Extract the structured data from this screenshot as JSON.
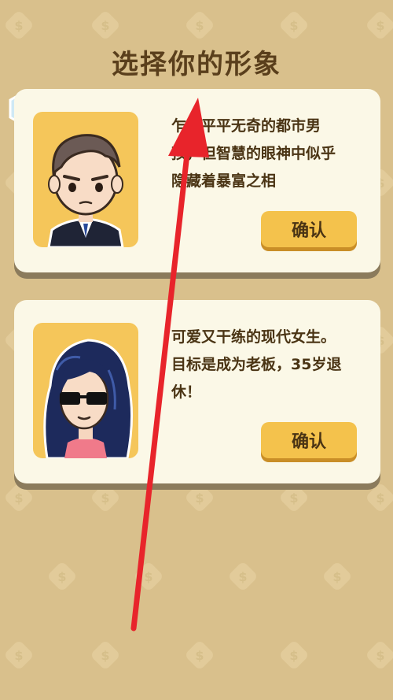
{
  "title": "选择你的形象",
  "characters": [
    {
      "description": "乍看平平无奇的都市男孩，但智慧的眼神中似乎隐藏着暴富之相",
      "confirm_label": "确认",
      "avatar": "male-avatar"
    },
    {
      "description": "可爱又干练的现代女生。目标是成为老板，35岁退休！",
      "confirm_label": "确认",
      "avatar": "female-avatar"
    }
  ],
  "colors": {
    "background": "#d9c08c",
    "card": "#fbf8e7",
    "button": "#f4c24c",
    "avatar_bg": "#f5c65a",
    "arrow": "#e8242b"
  }
}
